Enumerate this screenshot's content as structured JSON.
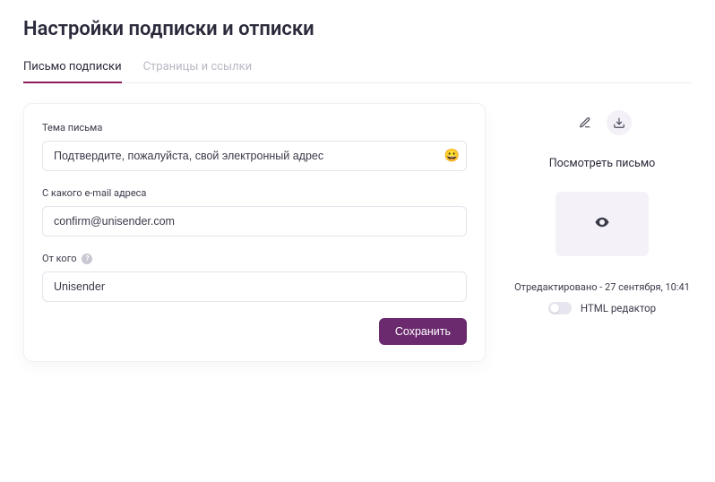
{
  "page": {
    "title": "Настройки подписки и отписки"
  },
  "tabs": [
    {
      "label": "Письмо подписки",
      "active": true
    },
    {
      "label": "Страницы и ссылки",
      "active": false
    }
  ],
  "form": {
    "subject": {
      "label": "Тема письма",
      "value": "Подтвердите, пожалуйста, свой электронный адрес"
    },
    "from_email": {
      "label": "С какого e-mail адреса",
      "value": "confirm@unisender.com"
    },
    "from_name": {
      "label": "От кого",
      "value": "Unisender"
    },
    "save_label": "Сохранить"
  },
  "side": {
    "preview_label": "Посмотреть письмо",
    "edited_text": "Отредактировано - 27 сентября, 10:41",
    "html_editor_label": "HTML редактор"
  },
  "icons": {
    "emoji": "😀",
    "edit": "edit-icon",
    "download": "download-icon",
    "eye": "eye-icon"
  }
}
